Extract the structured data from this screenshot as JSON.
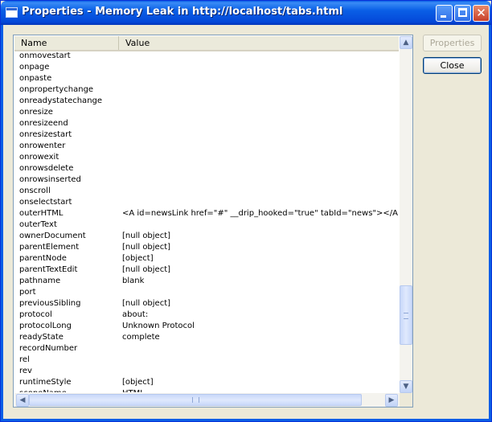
{
  "window": {
    "title": "Properties - Memory Leak in http://localhost/tabs.html"
  },
  "buttons": {
    "properties": "Properties",
    "close": "Close"
  },
  "columns": {
    "name": "Name",
    "value": "Value"
  },
  "rows": [
    {
      "name": "onmovestart",
      "value": ""
    },
    {
      "name": "onpage",
      "value": ""
    },
    {
      "name": "onpaste",
      "value": ""
    },
    {
      "name": "onpropertychange",
      "value": ""
    },
    {
      "name": "onreadystatechange",
      "value": ""
    },
    {
      "name": "onresize",
      "value": ""
    },
    {
      "name": "onresizeend",
      "value": ""
    },
    {
      "name": "onresizestart",
      "value": ""
    },
    {
      "name": "onrowenter",
      "value": ""
    },
    {
      "name": "onrowexit",
      "value": ""
    },
    {
      "name": "onrowsdelete",
      "value": ""
    },
    {
      "name": "onrowsinserted",
      "value": ""
    },
    {
      "name": "onscroll",
      "value": ""
    },
    {
      "name": "onselectstart",
      "value": ""
    },
    {
      "name": "outerHTML",
      "value": "<A id=newsLink href=\"#\" __drip_hooked=\"true\" tabId=\"news\"></A>"
    },
    {
      "name": "outerText",
      "value": ""
    },
    {
      "name": "ownerDocument",
      "value": "[null object]"
    },
    {
      "name": "parentElement",
      "value": "[null object]"
    },
    {
      "name": "parentNode",
      "value": "[object]"
    },
    {
      "name": "parentTextEdit",
      "value": "[null object]"
    },
    {
      "name": "pathname",
      "value": "blank"
    },
    {
      "name": "port",
      "value": ""
    },
    {
      "name": "previousSibling",
      "value": "[null object]"
    },
    {
      "name": "protocol",
      "value": "about:"
    },
    {
      "name": "protocolLong",
      "value": "Unknown Protocol"
    },
    {
      "name": "readyState",
      "value": "complete"
    },
    {
      "name": "recordNumber",
      "value": ""
    },
    {
      "name": "rel",
      "value": ""
    },
    {
      "name": "rev",
      "value": ""
    },
    {
      "name": "runtimeStyle",
      "value": "[object]"
    },
    {
      "name": "scopeName",
      "value": "HTML"
    }
  ],
  "icons": {
    "scroll_up": "▲",
    "scroll_down": "▼",
    "scroll_left": "◀",
    "scroll_right": "▶",
    "close": "✕"
  }
}
